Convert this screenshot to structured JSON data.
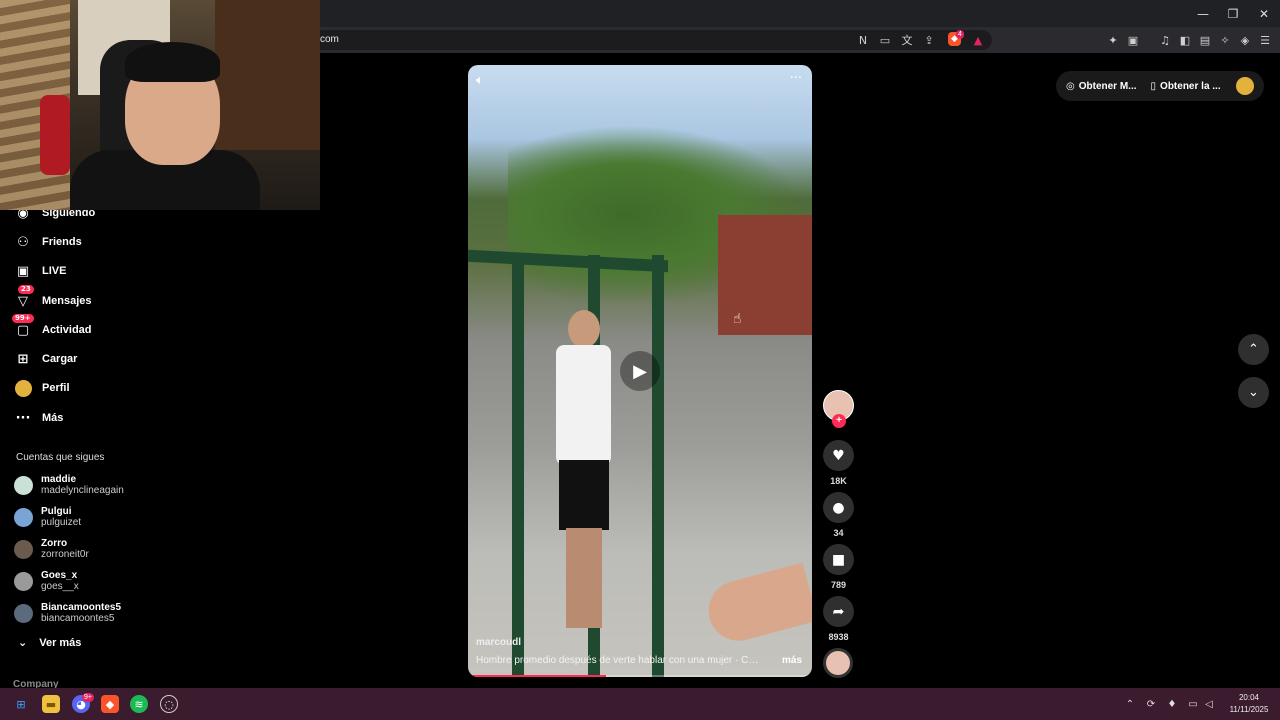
{
  "browser": {
    "url": "com",
    "window_controls": {
      "minimize": "—",
      "restore": "❐",
      "close": "✕"
    },
    "brave_badge": "4"
  },
  "sidebar": {
    "items": [
      {
        "label": "Siguiendo",
        "icon": "following-icon"
      },
      {
        "label": "Friends",
        "icon": "friends-icon"
      },
      {
        "label": "LIVE",
        "icon": "live-icon"
      },
      {
        "label": "Mensajes",
        "icon": "messages-icon",
        "badge": "23"
      },
      {
        "label": "Actividad",
        "icon": "activity-icon",
        "badge": "99+"
      },
      {
        "label": "Cargar",
        "icon": "upload-icon"
      },
      {
        "label": "Perfil",
        "icon": "profile-icon"
      },
      {
        "label": "Más",
        "icon": "more-icon"
      }
    ],
    "following_title": "Cuentas que sigues",
    "accounts": [
      {
        "name": "maddie",
        "username": "madelynclineagain"
      },
      {
        "name": "Pulgui",
        "username": "pulguizet"
      },
      {
        "name": "Zorro",
        "username": "zorroneit0r"
      },
      {
        "name": "Goes_x",
        "username": "goes__x"
      },
      {
        "name": "Biancamoontes5",
        "username": "biancamoontes5"
      }
    ],
    "see_more": "Ver más",
    "company": "Company"
  },
  "video": {
    "author": "marcoudl",
    "caption": "Hombre promedio después de verte hablar con una mujer · Con ...",
    "more_label": "más",
    "progress": 0.4
  },
  "actions": {
    "likes": "18K",
    "comments": "34",
    "saves": "789",
    "shares": "8938"
  },
  "top_right": {
    "get_mode": "Obtener M...",
    "get_app": "Obtener la ..."
  },
  "taskbar": {
    "time": "20:04",
    "date": "11/11/2025",
    "discord_badge": "9+"
  },
  "colors": {
    "accent": "#fe2c55",
    "taskbar": "#3b1b2e"
  }
}
